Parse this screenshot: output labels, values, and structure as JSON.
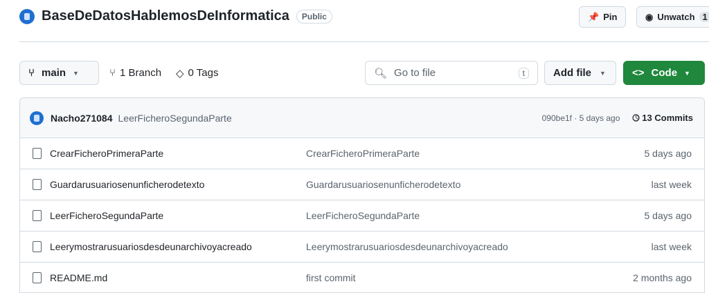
{
  "repo": {
    "name": "BaseDeDatosHablemosDeInformatica",
    "visibility": "Public",
    "pin": "Pin",
    "unwatch": "Unwatch",
    "watch_count": "1"
  },
  "toolbar": {
    "branch": "main",
    "branches": "1 Branch",
    "tags": "0 Tags",
    "search_placeholder": "Go to file",
    "search_key": "t",
    "add_file": "Add file",
    "code": "Code"
  },
  "commit": {
    "author": "Nacho271084",
    "message": "LeerFicheroSegundaParte",
    "meta": "090be1f · 5 days ago",
    "commits": "13 Commits"
  },
  "files": [
    {
      "name": "CrearFicheroPrimeraParte",
      "message": "CrearFicheroPrimeraParte",
      "age": "5 days ago"
    },
    {
      "name": "Guardarusuariosenunficherodetexto",
      "message": "Guardarusuariosenunficherodetexto",
      "age": "last week"
    },
    {
      "name": "LeerFicheroSegundaParte",
      "message": "LeerFicheroSegundaParte",
      "age": "5 days ago"
    },
    {
      "name": "Leerymostrarusuariosdesdeunarchivoyacreado",
      "message": "Leerymostrarusuariosdesdeunarchivoyacreado",
      "age": "last week"
    },
    {
      "name": "README.md",
      "message": "first commit",
      "age": "2 months ago"
    }
  ],
  "colors": {
    "primary": "#1f883d",
    "accent": "#1f6fd0"
  }
}
